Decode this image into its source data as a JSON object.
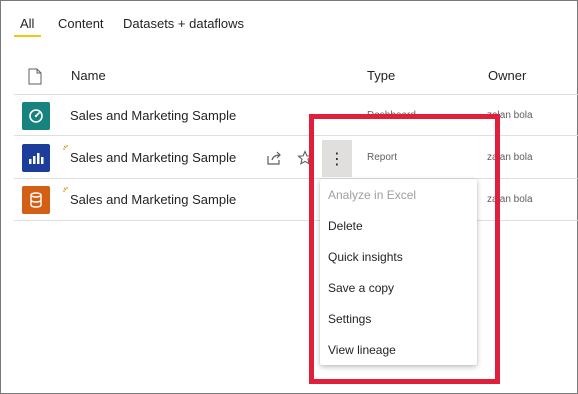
{
  "tabs": [
    {
      "label": "All",
      "active": true
    },
    {
      "label": "Content",
      "active": false
    },
    {
      "label": "Datasets + dataflows",
      "active": false
    }
  ],
  "columns": {
    "name": "Name",
    "type": "Type",
    "owner": "Owner"
  },
  "rows": [
    {
      "name": "Sales and Marketing Sample",
      "type": "Dashboard",
      "owner": "zalan bola",
      "icon": "dashboard-icon"
    },
    {
      "name": "Sales and Marketing Sample",
      "type": "Report",
      "owner": "zalan bola",
      "icon": "report-icon"
    },
    {
      "name": "Sales and Marketing Sample",
      "type": "",
      "owner": "zalan bola",
      "icon": "dataset-icon"
    }
  ],
  "more_label": "⋮",
  "context_menu": {
    "items": [
      {
        "label": "Analyze in Excel",
        "disabled": true
      },
      {
        "label": "Delete",
        "disabled": false
      },
      {
        "label": "Quick insights",
        "disabled": false
      },
      {
        "label": "Save a copy",
        "disabled": false
      },
      {
        "label": "Settings",
        "disabled": false
      },
      {
        "label": "View lineage",
        "disabled": false
      }
    ]
  },
  "colors": {
    "accent_underline": "#f2c811",
    "highlight_border": "#e0203a",
    "dashboard_icon": "#17827e",
    "report_icon": "#1c3e9a",
    "dataset_icon": "#d35f14"
  }
}
